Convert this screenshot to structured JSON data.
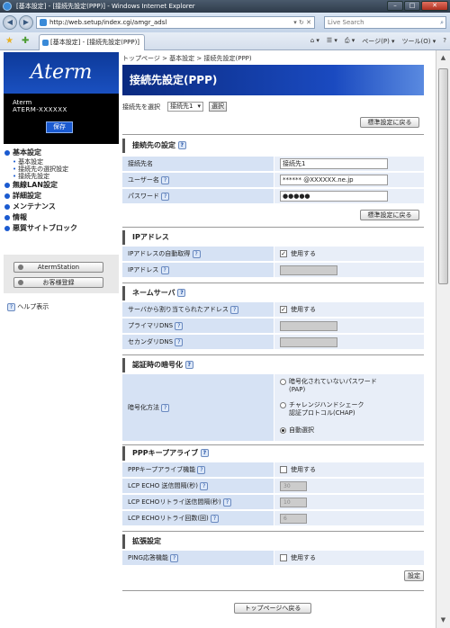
{
  "window": {
    "title": "[基本設定] - [接続先設定(PPP)] - Windows Internet Explorer",
    "minimize": "–",
    "maximize": "□",
    "close": "✕"
  },
  "nav": {
    "back": "◀",
    "forward": "▶"
  },
  "address": {
    "url": "http://web.setup/index.cgi/amgr_adsl",
    "tools": "▾ ↻ ✕"
  },
  "search": {
    "placeholder": "Live Search",
    "icon": "⌕"
  },
  "tab": {
    "title": "[基本設定] - [接続先設定(PPP)]"
  },
  "toolbar": {
    "home": "⌂ ▾",
    "feeds": "☰ ▾",
    "print": "⎙ ▾",
    "page": "ページ(P) ▾",
    "tools": "ツール(O) ▾",
    "help": "?"
  },
  "sidebar": {
    "logo": "Aterm",
    "model_line1": "Aterm",
    "model_line2": "ATERM-XXXXXX",
    "save": "保存",
    "menu": [
      {
        "label": "基本設定",
        "sub": [
          "基本設定",
          "接続先の選択設定",
          "接続先設定"
        ]
      },
      {
        "label": "無線LAN設定",
        "sub": []
      },
      {
        "label": "詳細設定",
        "sub": []
      },
      {
        "label": "メンテナンス",
        "sub": []
      },
      {
        "label": "情報",
        "sub": []
      },
      {
        "label": "悪質サイトブロック",
        "sub": []
      }
    ],
    "atermstation": "AtermStation",
    "user_reg": "お客様登録",
    "help": "ヘルプ表示"
  },
  "main": {
    "breadcrumb": "トップページ > 基本設定 > 接続先設定(PPP)",
    "title": "接続先設定(PPP)",
    "select_label": "接続先を選択",
    "select_value": "接続先1",
    "select_button": "選択",
    "reset_top": "標準設定に戻る",
    "reset_mid": "標準設定に戻る",
    "conn": {
      "head": "接続先の設定",
      "name_label": "接続先名",
      "name_value": "接続先1",
      "user_label": "ユーザー名",
      "user_value": "****** @XXXXXX.ne.jp",
      "pass_label": "パスワード",
      "pass_value": "●●●●●"
    },
    "ip": {
      "head": "IPアドレス",
      "auto_label": "IPアドレスの自動取得",
      "auto_check": "使用する",
      "addr_label": "IPアドレス"
    },
    "ns": {
      "head": "ネームサーバ",
      "assigned_label": "サーバから割り当てられたアドレス",
      "assigned_check": "使用する",
      "primary_label": "プライマリDNS",
      "secondary_label": "セカンダリDNS"
    },
    "auth": {
      "head": "認証時の暗号化",
      "method_label": "暗号化方法",
      "opt1": "暗号化されていないパスワード",
      "opt1b": "(PAP)",
      "opt2": "チャレンジハンドシェーク",
      "opt2b": "認証プロトコル(CHAP)",
      "opt3": "自動選択"
    },
    "keep": {
      "head": "PPPキープアライブ",
      "func_label": "PPPキープアライブ機能",
      "func_check": "使用する",
      "echo_label": "LCP ECHO 送信間隔(秒)",
      "echo_value": "30",
      "retry_int_label": "LCP ECHOリトライ送信間隔(秒)",
      "retry_int_value": "10",
      "retry_cnt_label": "LCP ECHOリトライ回数(回)",
      "retry_cnt_value": "6"
    },
    "ext": {
      "head": "拡張設定",
      "ping_label": "PING応答機能",
      "ping_check": "使用する"
    },
    "apply": "設定",
    "back_top": "トップページへ戻る"
  }
}
